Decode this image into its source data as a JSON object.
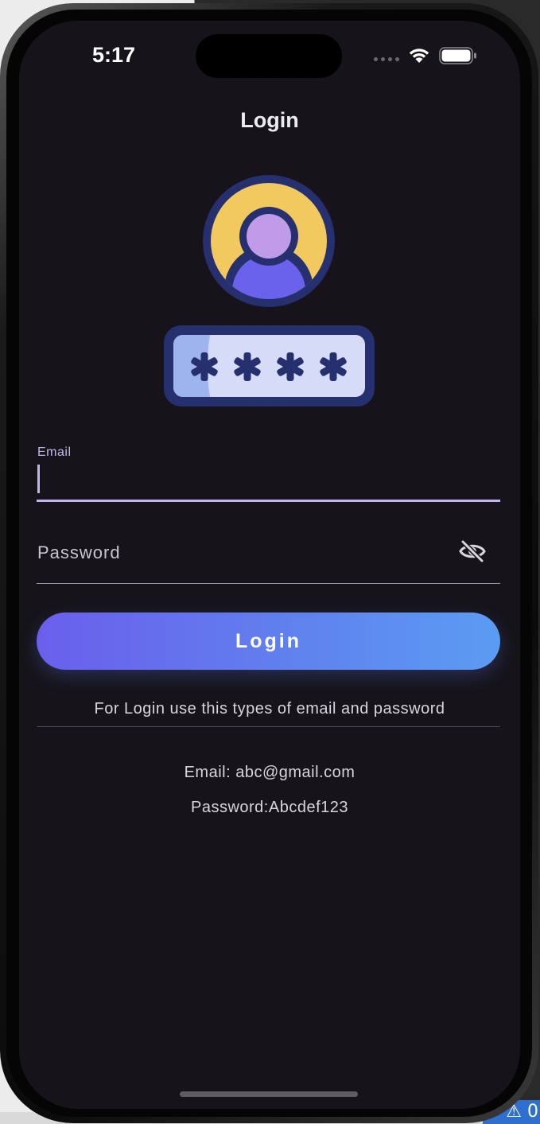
{
  "status_bar": {
    "time": "5:17",
    "wifi_icon": "wifi-icon",
    "battery_icon": "battery-icon"
  },
  "nav": {
    "title": "Login"
  },
  "illustration": {
    "icon": "user-password-icon",
    "password_mask": "****"
  },
  "form": {
    "email_label": "Email",
    "email_value": "",
    "password_placeholder": "Password",
    "password_value": "",
    "visibility_icon": "eye-off-icon",
    "login_button_label": "Login"
  },
  "hint": {
    "text": "For Login use this types of email and password",
    "email": "Email: abc@gmail.com",
    "password": "Password:Abcdef123"
  },
  "colors": {
    "background": "#16141a",
    "accent": "#c6b4f2",
    "button_gradient_start": "#6a5fec",
    "button_gradient_end": "#5b9cf3"
  }
}
